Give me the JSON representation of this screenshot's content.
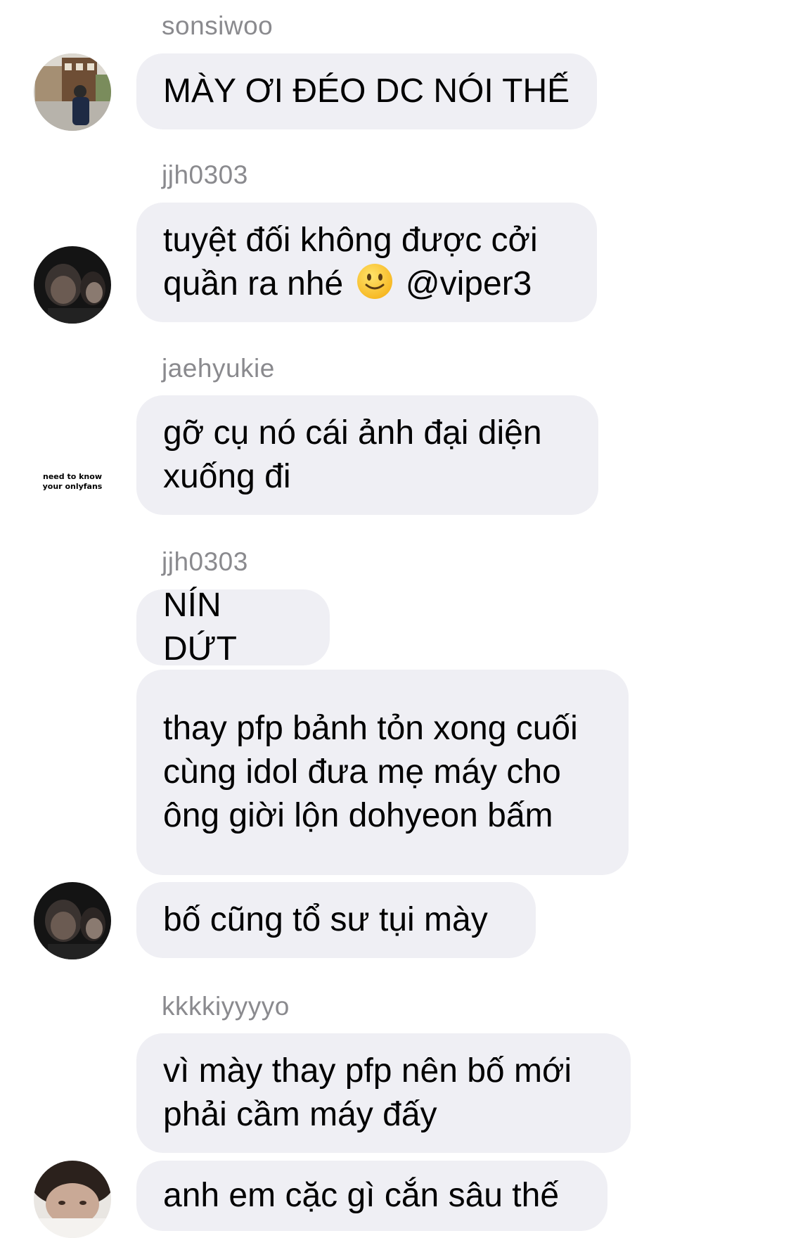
{
  "messages": [
    {
      "username": "sonsiwoo",
      "bubbles": [
        "MÀY ƠI ĐÉO DC NÓI THẾ"
      ],
      "avatar": "photo-avatar-street"
    },
    {
      "username": "jjh0303",
      "bubbles": [
        {
          "before": "tuyệt đối không được cởi quần ra nhé",
          "emoji": "slightly-smiling-face-icon",
          "after": "@viper3"
        }
      ],
      "avatar": "photo-avatar-dark"
    },
    {
      "username": "jaehyukie",
      "bubbles": [
        "gỡ cụ nó cái ảnh đại diện xuống đi"
      ],
      "avatar_text": [
        "need to know",
        "your onlyfans"
      ]
    },
    {
      "username": "jjh0303",
      "bubbles": [
        "NÍN DỨT",
        "thay pfp bảnh tỏn xong cuối cùng idol đưa mẹ máy cho ông giời lộn dohyeon bấm",
        "bố cũng tổ sư tụi mày"
      ],
      "avatar": "photo-avatar-dark"
    },
    {
      "username": "kkkkiyyyyo",
      "bubbles": [
        "vì mày thay pfp nên bố mới phải cầm máy đấy",
        "anh em cặc gì cắn sâu thế"
      ],
      "avatar": "photo-avatar-face"
    }
  ],
  "colors": {
    "bubble_bg": "#efeff4",
    "username": "#8a8a8e",
    "text": "#000000",
    "background": "#ffffff"
  }
}
